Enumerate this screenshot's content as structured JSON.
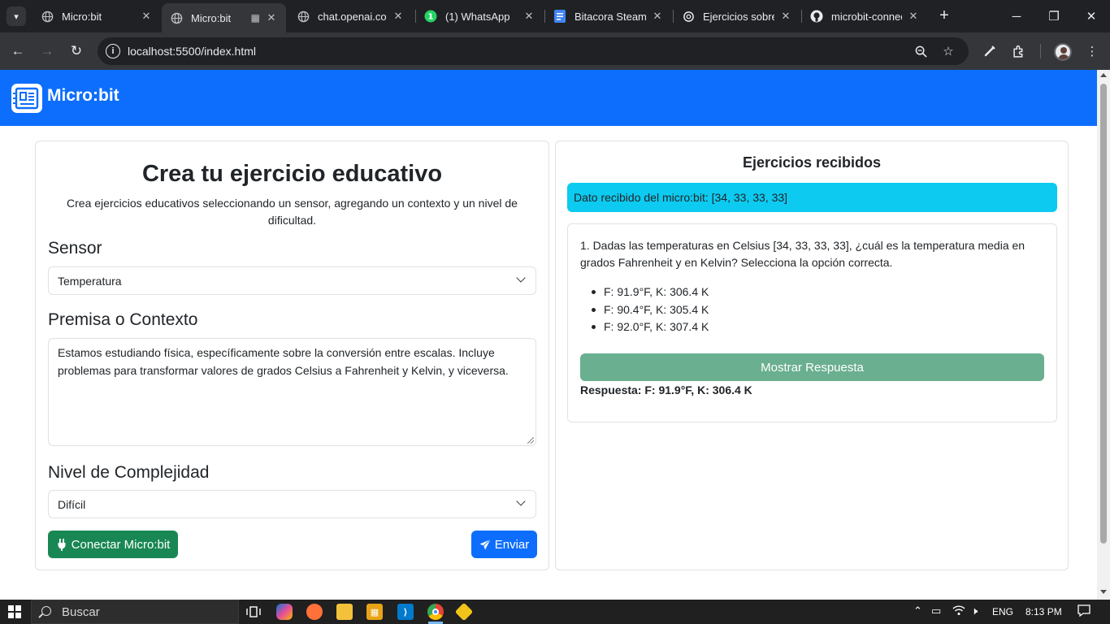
{
  "browser": {
    "tabs": [
      {
        "title": "Micro:bit",
        "icon": "globe-icon"
      },
      {
        "title": "Micro:bit",
        "icon": "globe-icon",
        "active": true
      },
      {
        "title": "chat.openai.com",
        "icon": "globe-icon"
      },
      {
        "title": "(1) WhatsApp",
        "icon": "whatsapp-icon"
      },
      {
        "title": "Bitacora Steam I",
        "icon": "docs-icon"
      },
      {
        "title": "Ejercicios sobre",
        "icon": "openai-icon"
      },
      {
        "title": "microbit-connec",
        "icon": "github-icon"
      }
    ],
    "url": "localhost:5500/index.html"
  },
  "navbar": {
    "brand": "Micro:bit"
  },
  "form": {
    "title": "Crea tu ejercicio educativo",
    "subtitle": "Crea ejercicios educativos seleccionando un sensor, agregando un contexto y un nivel de dificultad.",
    "sensor_label": "Sensor",
    "sensor_value": "Temperatura",
    "context_label": "Premisa o Contexto",
    "context_value": "Estamos estudiando física, específicamente sobre la conversión entre escalas. Incluye problemas para transformar valores de grados Celsius a Fahrenheit y Kelvin, y viceversa.",
    "level_label": "Nivel de Complejidad",
    "level_value": "Difícil",
    "connect_button": "Conectar Micro:bit",
    "send_button": "Enviar"
  },
  "results": {
    "title": "Ejercicios recibidos",
    "received_data": "Dato recibido del micro:bit: [34, 33, 33, 33]",
    "question": "1. Dadas las temperaturas en Celsius [34, 33, 33, 33], ¿cuál es la temperatura media en grados Fahrenheit y en Kelvin? Selecciona la opción correcta.",
    "options": [
      "F: 91.9°F, K: 306.4 K",
      "F: 90.4°F, K: 305.4 K",
      "F: 92.0°F, K: 307.4 K"
    ],
    "show_answer_button": "Mostrar Respuesta",
    "answer": "Respuesta: F: 91.9°F, K: 306.4 K"
  },
  "taskbar": {
    "search_placeholder": "Buscar",
    "language": "ENG",
    "time": "8:13 PM"
  },
  "colors": {
    "primary": "#0d6efd",
    "success": "#198754",
    "info": "#0dcaf0",
    "show_answer": "#6aaf8f"
  }
}
